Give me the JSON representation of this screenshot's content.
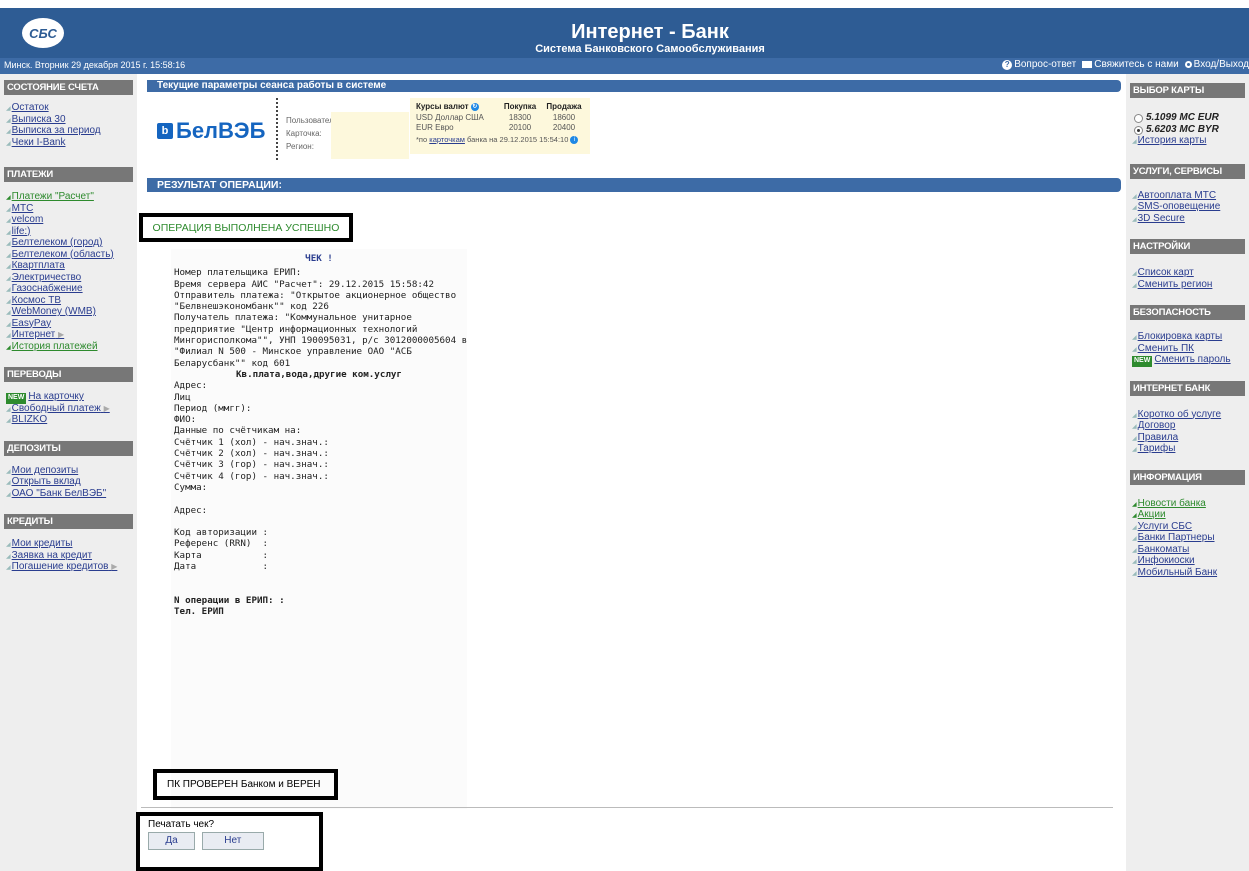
{
  "header": {
    "logo_text": "СБС",
    "title": "Интернет - Банк",
    "subtitle": "Система Банковского Самообслуживания"
  },
  "subbar": {
    "datetime": "Минск. Вторник 29 декабря 2015 г. 15:58:16",
    "links": [
      "Вопрос-ответ",
      "Свяжитесь с нами",
      "Вход/Выход"
    ]
  },
  "leftnav": {
    "sections": [
      {
        "title": "СОСТОЯНИЕ СЧЕТА",
        "items": [
          "Остаток",
          "Выписка 30",
          "Выписка за период",
          "Чеки I-Bank"
        ]
      },
      {
        "title": "ПЛАТЕЖИ",
        "items": [
          "Платежи \"Расчет\"",
          "МТС",
          "velcom",
          "life:)",
          "Белтелеком (город)",
          "Белтелеком (область)",
          "Квартплата",
          "Электричество",
          "Газоснабжение",
          "Космос ТВ",
          "WebMoney (WMB)",
          "EasyPay",
          "Интернет",
          "История платежей"
        ]
      },
      {
        "title": "ПЕРЕВОДЫ",
        "items": [
          "На карточку",
          "Свободный платеж",
          "BLIZKO"
        ]
      },
      {
        "title": "ДЕПОЗИТЫ",
        "items": [
          "Мои депозиты",
          "Открыть вклад",
          "ОАО \"Банк БелВЭБ\""
        ]
      },
      {
        "title": "КРЕДИТЫ",
        "items": [
          "Мои кредиты",
          "Заявка на кредит",
          "Погашение кредитов"
        ]
      }
    ],
    "new_badge": "NEW"
  },
  "rightnav": {
    "cards_title": "ВЫБОР КАРТЫ",
    "cards": [
      "5.1099 MC EUR",
      "5.6203 MC BYR"
    ],
    "card_history": "История карты",
    "sections": [
      {
        "title": "УСЛУГИ, СЕРВИСЫ",
        "items": [
          "Автооплата МТС",
          "SMS-оповещение",
          "3D Secure"
        ]
      },
      {
        "title": "НАСТРОЙКИ",
        "items": [
          "Список карт",
          "Сменить регион"
        ]
      },
      {
        "title": "БЕЗОПАСНОСТЬ",
        "items": [
          "Блокировка карты",
          "Сменить ПК",
          "Сменить пароль"
        ]
      },
      {
        "title": "ИНТЕРНЕТ БАНК",
        "items": [
          "Коротко об услуге",
          "Договор",
          "Правила",
          "Тарифы"
        ]
      },
      {
        "title": "ИНФОРМАЦИЯ",
        "items": [
          "Новости банка",
          "Акции",
          "Услуги СБС",
          "Банки Партнеры",
          "Банкоматы",
          "Инфокиоски",
          "Мобильный Банк"
        ]
      }
    ]
  },
  "session": {
    "bar_title": "Текущие параметры сеанса работы в системе",
    "bank_logo": "БелВЭБ",
    "fields": [
      "Пользователь:",
      "Карточка:",
      "Регион:"
    ],
    "rates": {
      "header": [
        "Курсы валют",
        "Покупка",
        "Продажа"
      ],
      "rows": [
        {
          "cur": "USD Доллар США",
          "buy": "18300",
          "sell": "18600"
        },
        {
          "cur": "EUR Евро",
          "buy": "20100",
          "sell": "20400"
        }
      ],
      "note_prefix": "*по",
      "note_link": "карточкам",
      "note_suffix": "банка на 29.12.2015 15:54:10"
    }
  },
  "result": {
    "bar_title": "РЕЗУЛЬТАТ ОПЕРАЦИИ:",
    "success": "ОПЕРАЦИЯ ВЫПОЛНЕНА УСПЕШНО",
    "receipt_title": "ЧЕК !",
    "receipt_lines": [
      "Номер плательщика ЕРИП:",
      "Время сервера АИС \"Расчет\": 29.12.2015 15:58:42",
      "Отправитель платежа: \"Открытое акционерное общество",
      "\"Белвнешэкономбанк\"\" код 226",
      "Получатель платежа: \"Коммунальное унитарное",
      "предприятие \"Центр информационных технологий",
      "Мингорисполкома\"\", УНП 190095031, р/с 3012000005604 в",
      "\"Филиал N 500 - Минское управление ОАО \"АСБ",
      "Беларусбанк\"\" код 601"
    ],
    "receipt_service": "Кв.плата,вода,другие ком.услуг",
    "receipt_lines2": [
      "Адрес:",
      "Лиц",
      "Период (ммгг):",
      "ФИО:",
      "Данные по счётчикам на:",
      "Счётчик 1 (хол) - нач.знач.:",
      "Счётчик 2 (хол) - нач.знач.:",
      "Счётчик 3 (гор) - нач.знач.:",
      "Счётчик 4 (гор) - нач.знач.:",
      "Сумма:",
      "",
      "Адрес:",
      "",
      "Код авторизации :",
      "Референс (RRN)  :",
      "Карта           :",
      "Дата            :",
      "",
      ""
    ],
    "receipt_erip_op": "N операции в ЕРИП: :",
    "receipt_erip_tel": "Тел. ЕРИП",
    "pk_status": "ПК ПРОВЕРЕН Банком и ВЕРЕН",
    "print_question": "Печатать чек?",
    "btn_yes": "Да",
    "btn_no": "Нет"
  },
  "colors": {
    "header_blue": "#2e5c94",
    "bar_blue": "#3d6ba6",
    "link_blue": "#2a3d8f",
    "link_green": "#2d8a2d",
    "section_gray": "#777777"
  }
}
